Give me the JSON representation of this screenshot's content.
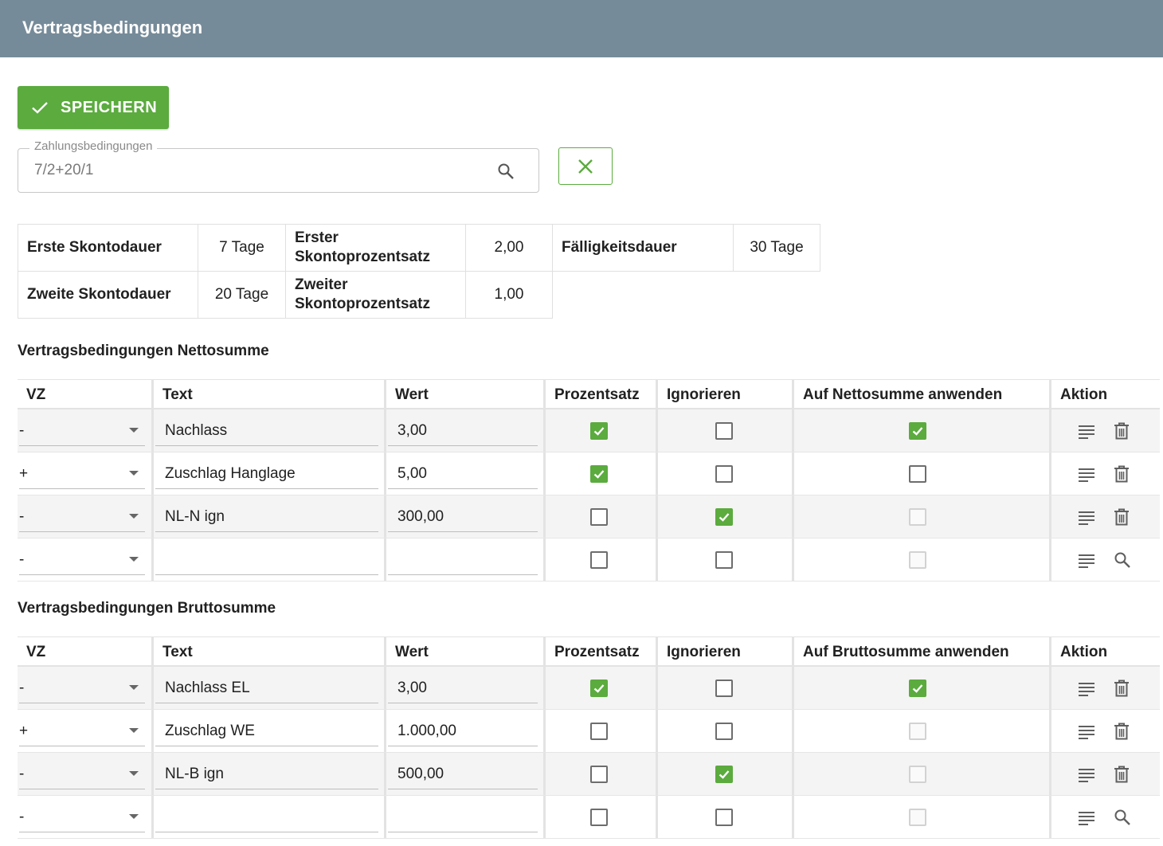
{
  "header": {
    "title": "Vertragsbedingungen"
  },
  "toolbar": {
    "save_label": "SPEICHERN"
  },
  "payment": {
    "legend": "Zahlungsbedingungen",
    "value": "7/2+20/1"
  },
  "terms": {
    "first_discount_label": "Erste Skontodauer",
    "first_discount_value": "7 Tage",
    "first_percent_label": "Erster Skontoprozentsatz",
    "first_percent_value": "2,00",
    "due_label": "Fälligkeitsdauer",
    "due_value": "30 Tage",
    "second_discount_label": "Zweite Skontodauer",
    "second_discount_value": "20 Tage",
    "second_percent_label": "Zweiter Skontoprozentsatz",
    "second_percent_value": "1,00"
  },
  "net": {
    "title": "Vertragsbedingungen Nettosumme",
    "headers": {
      "vz": "VZ",
      "text": "Text",
      "wert": "Wert",
      "prozent": "Prozentsatz",
      "ignorieren": "Ignorieren",
      "anwenden": "Auf Nettosumme anwenden",
      "aktion": "Aktion"
    },
    "rows": [
      {
        "vz": "-",
        "text": "Nachlass",
        "wert": "3,00",
        "prozent": true,
        "ignorieren": false,
        "anwenden": "checked",
        "action": "delete"
      },
      {
        "vz": "+",
        "text": "Zuschlag Hanglage",
        "wert": "5,00",
        "prozent": true,
        "ignorieren": false,
        "anwenden": "unchecked",
        "action": "delete"
      },
      {
        "vz": "-",
        "text": "NL-N ign",
        "wert": "300,00",
        "prozent": false,
        "ignorieren": true,
        "anwenden": "disabled",
        "action": "delete"
      },
      {
        "vz": "-",
        "text": "",
        "wert": "",
        "prozent": false,
        "ignorieren": false,
        "anwenden": "disabled",
        "action": "search"
      }
    ]
  },
  "gross": {
    "title": "Vertragsbedingungen Bruttosumme",
    "headers": {
      "vz": "VZ",
      "text": "Text",
      "wert": "Wert",
      "prozent": "Prozentsatz",
      "ignorieren": "Ignorieren",
      "anwenden": "Auf Bruttosumme anwenden",
      "aktion": "Aktion"
    },
    "rows": [
      {
        "vz": "-",
        "text": "Nachlass EL",
        "wert": "3,00",
        "prozent": true,
        "ignorieren": false,
        "anwenden": "checked",
        "action": "delete"
      },
      {
        "vz": "+",
        "text": "Zuschlag WE",
        "wert": "1.000,00",
        "prozent": false,
        "ignorieren": false,
        "anwenden": "disabled",
        "action": "delete"
      },
      {
        "vz": "-",
        "text": "NL-B ign",
        "wert": "500,00",
        "prozent": false,
        "ignorieren": true,
        "anwenden": "disabled",
        "action": "delete"
      },
      {
        "vz": "-",
        "text": "",
        "wert": "",
        "prozent": false,
        "ignorieren": false,
        "anwenden": "disabled",
        "action": "search"
      }
    ]
  },
  "colors": {
    "accent": "#5bab3e",
    "titlebar": "#768b99"
  }
}
